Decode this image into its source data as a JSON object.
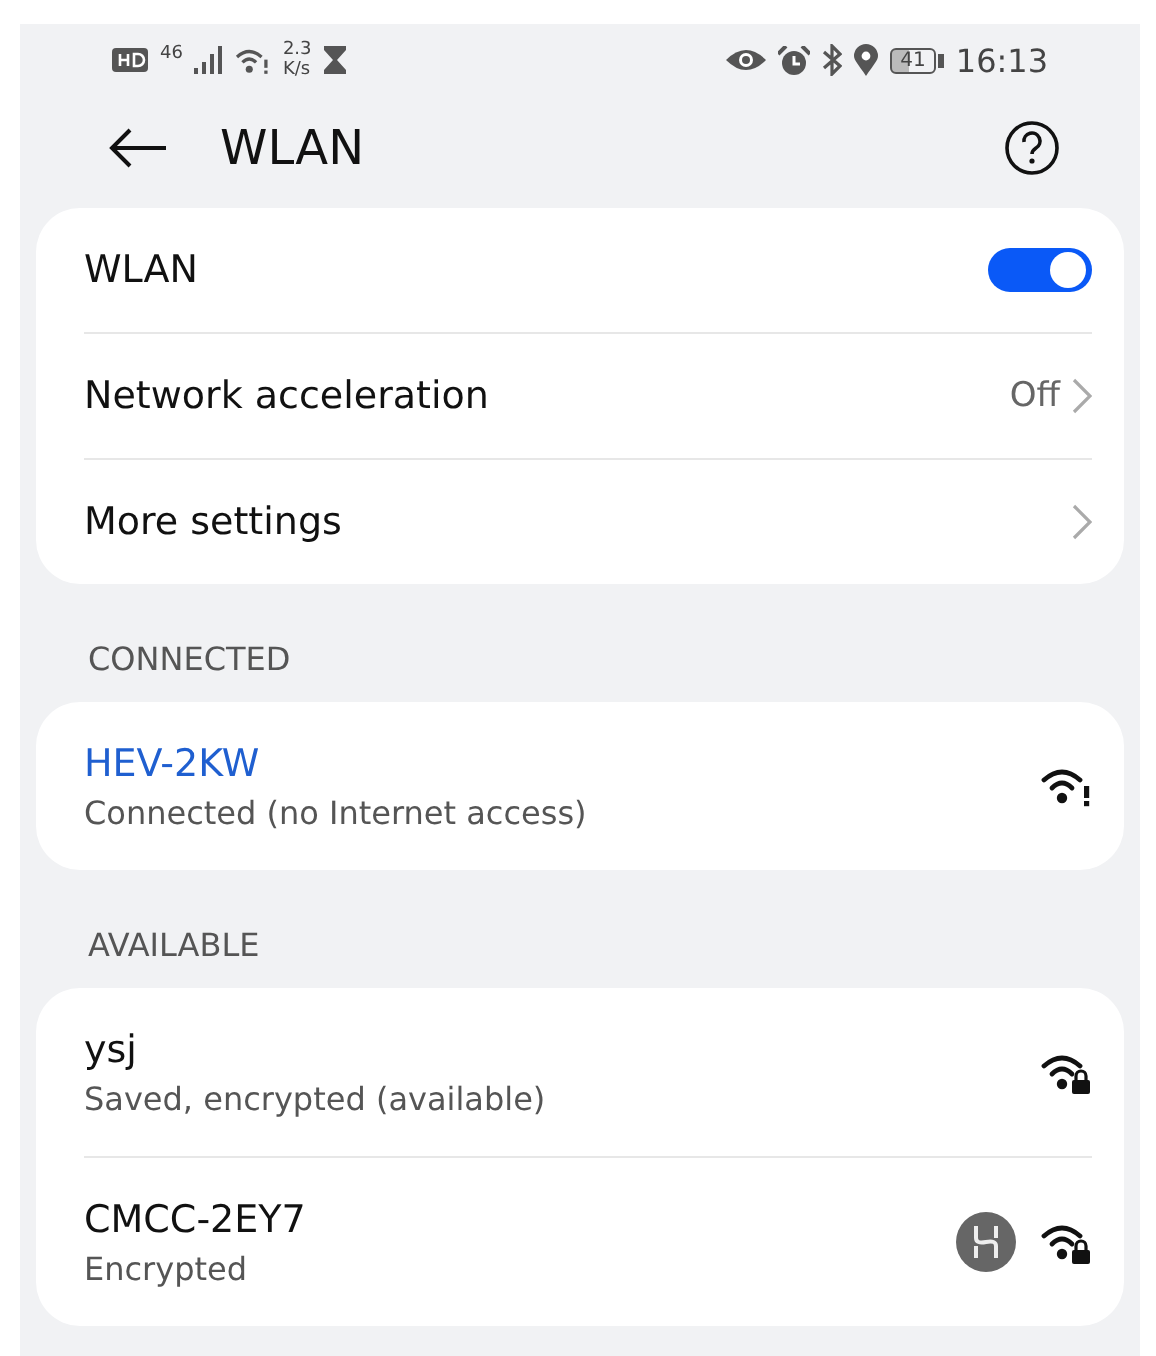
{
  "status_bar": {
    "network": "46",
    "speed_value": "2.3",
    "speed_unit": "K/s",
    "battery": "41",
    "time": "16:13"
  },
  "header": {
    "title": "WLAN"
  },
  "settings": [
    {
      "kind": "toggle",
      "label": "WLAN",
      "on": true
    },
    {
      "kind": "link",
      "label": "Network acceleration",
      "value": "Off"
    },
    {
      "kind": "link",
      "label": "More settings"
    }
  ],
  "sections": [
    {
      "title": "CONNECTED",
      "networks": [
        {
          "name": "HEV-2KW",
          "status": "Connected (no Internet access)",
          "connected": true,
          "kind": "alert",
          "hilink": false
        }
      ]
    },
    {
      "title": "AVAILABLE",
      "networks": [
        {
          "name": "ysj",
          "status": "Saved, encrypted (available)",
          "connected": false,
          "kind": "locked",
          "hilink": false
        },
        {
          "name": "CMCC-2EY7",
          "status": "Encrypted",
          "connected": false,
          "kind": "locked",
          "hilink": true
        }
      ]
    }
  ]
}
